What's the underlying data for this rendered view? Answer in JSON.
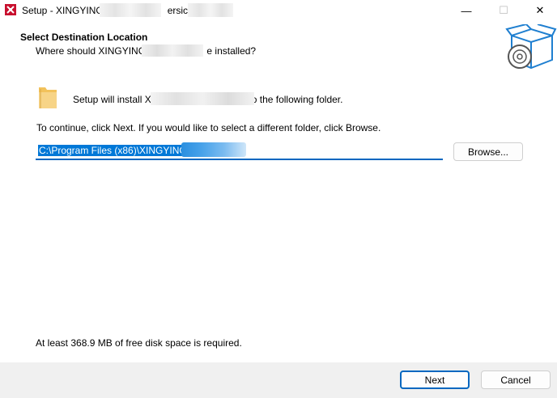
{
  "window": {
    "title_prefix": "Setup - XINGYING",
    "title_suffix": "ersic",
    "controls": {
      "minimize": "—",
      "maximize": "☐",
      "close": "✕"
    },
    "icon": "setup-app-icon"
  },
  "header": {
    "title": "Select Destination Location",
    "subtitle_prefix": "Where should XINGYINC",
    "subtitle_suffix": "e installed?",
    "image_icon": "install-box-icon"
  },
  "body": {
    "folder_icon": "folder-icon",
    "install_prefix": "Setup will install XINGYI",
    "install_suffix": "to the following folder.",
    "continue_text": "To continue, click Next. If you would like to select a different folder, click Browse.",
    "path_value": "C:\\Program Files (x86)\\XINGYING",
    "browse_label": "Browse...",
    "disk_space_text": "At least 368.9 MB of free disk space is required."
  },
  "footer": {
    "next_label": "Next",
    "cancel_label": "Cancel"
  },
  "colors": {
    "accent": "#0067c0",
    "selection": "#0078d7",
    "footer_bg": "#f0f0f0",
    "app_icon": "#c8102e"
  }
}
